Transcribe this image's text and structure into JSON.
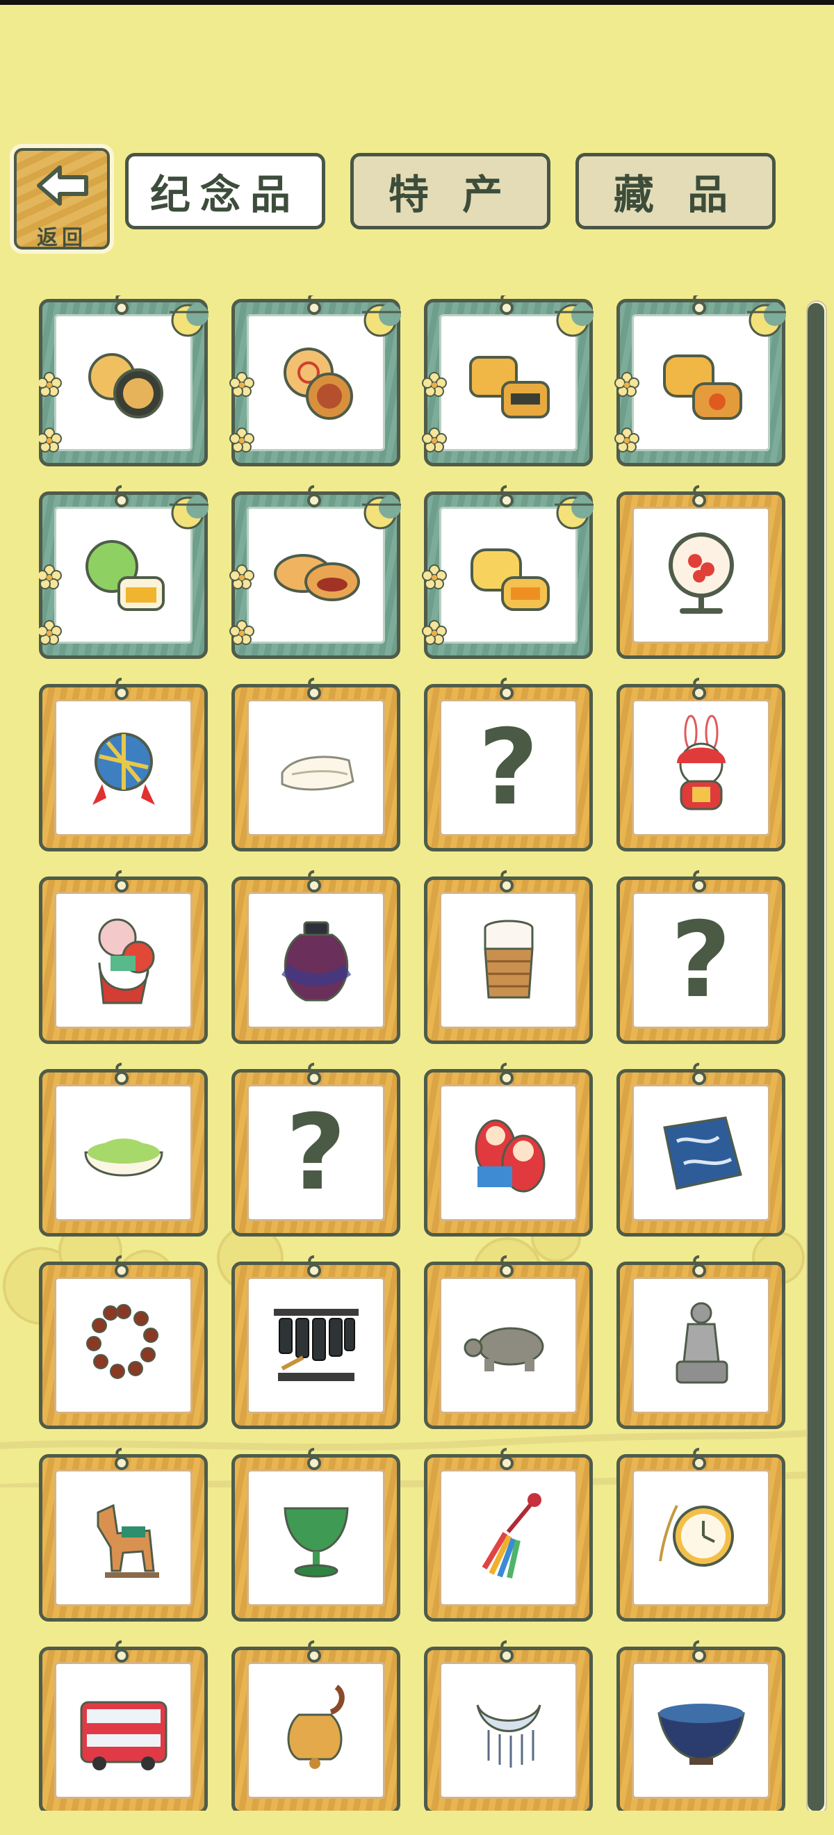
{
  "back_button": {
    "label": "返回",
    "icon": "left-arrow-icon"
  },
  "tabs": [
    {
      "label": "纪念品",
      "active": true
    },
    {
      "label": "特 产",
      "active": false
    },
    {
      "label": "藏 品",
      "active": false
    }
  ],
  "colors": {
    "background": "#f1eb8f",
    "frame_gold": "#e0ac4b",
    "frame_festival_green": "#76a692",
    "outline": "#4e5c49"
  },
  "grid": {
    "columns": 4,
    "items": [
      {
        "icon": "mooncake-black-sesame-icon",
        "frame": "festival",
        "unlocked": true
      },
      {
        "icon": "mooncake-red-stamp-icon",
        "frame": "festival",
        "unlocked": true
      },
      {
        "icon": "mooncake-square-pattern-icon",
        "frame": "festival",
        "unlocked": true
      },
      {
        "icon": "mooncake-flower-icon",
        "frame": "festival",
        "unlocked": true
      },
      {
        "icon": "mooncake-green-icon",
        "frame": "festival",
        "unlocked": true
      },
      {
        "icon": "mooncake-red-filling-icon",
        "frame": "festival",
        "unlocked": true
      },
      {
        "icon": "mooncake-yellow-icon",
        "frame": "festival",
        "unlocked": true
      },
      {
        "icon": "embroidery-screen-icon",
        "frame": "standard",
        "unlocked": true
      },
      {
        "icon": "embroidered-ball-icon",
        "frame": "standard",
        "unlocked": true
      },
      {
        "icon": "folded-cloth-icon",
        "frame": "standard",
        "unlocked": true
      },
      {
        "icon": "unknown-item-icon",
        "frame": "standard",
        "unlocked": false
      },
      {
        "icon": "rabbit-figurine-icon",
        "frame": "standard",
        "unlocked": true
      },
      {
        "icon": "clay-figurine-icon",
        "frame": "standard",
        "unlocked": true
      },
      {
        "icon": "porcelain-jar-icon",
        "frame": "standard",
        "unlocked": true
      },
      {
        "icon": "woven-cup-icon",
        "frame": "standard",
        "unlocked": true
      },
      {
        "icon": "unknown-item-icon",
        "frame": "standard",
        "unlocked": false
      },
      {
        "icon": "matcha-powder-icon",
        "frame": "standard",
        "unlocked": true
      },
      {
        "icon": "unknown-item-icon",
        "frame": "standard",
        "unlocked": false
      },
      {
        "icon": "nesting-dolls-icon",
        "frame": "standard",
        "unlocked": true
      },
      {
        "icon": "indigo-cloth-icon",
        "frame": "standard",
        "unlocked": true
      },
      {
        "icon": "prayer-beads-icon",
        "frame": "standard",
        "unlocked": true
      },
      {
        "icon": "chime-bells-icon",
        "frame": "standard",
        "unlocked": true
      },
      {
        "icon": "stone-turtle-icon",
        "frame": "standard",
        "unlocked": true
      },
      {
        "icon": "terracotta-warrior-icon",
        "frame": "standard",
        "unlocked": true
      },
      {
        "icon": "tang-horse-icon",
        "frame": "standard",
        "unlocked": true
      },
      {
        "icon": "jade-cup-icon",
        "frame": "standard",
        "unlocked": true
      },
      {
        "icon": "tassel-knot-icon",
        "frame": "standard",
        "unlocked": true
      },
      {
        "icon": "pocket-watch-icon",
        "frame": "standard",
        "unlocked": true
      },
      {
        "icon": "double-decker-bus-icon",
        "frame": "standard",
        "unlocked": true
      },
      {
        "icon": "cowbell-icon",
        "frame": "standard",
        "unlocked": true
      },
      {
        "icon": "silver-necklace-icon",
        "frame": "standard",
        "unlocked": true
      },
      {
        "icon": "tea-bowl-icon",
        "frame": "standard",
        "unlocked": true
      }
    ]
  },
  "unknown_glyph": "?"
}
